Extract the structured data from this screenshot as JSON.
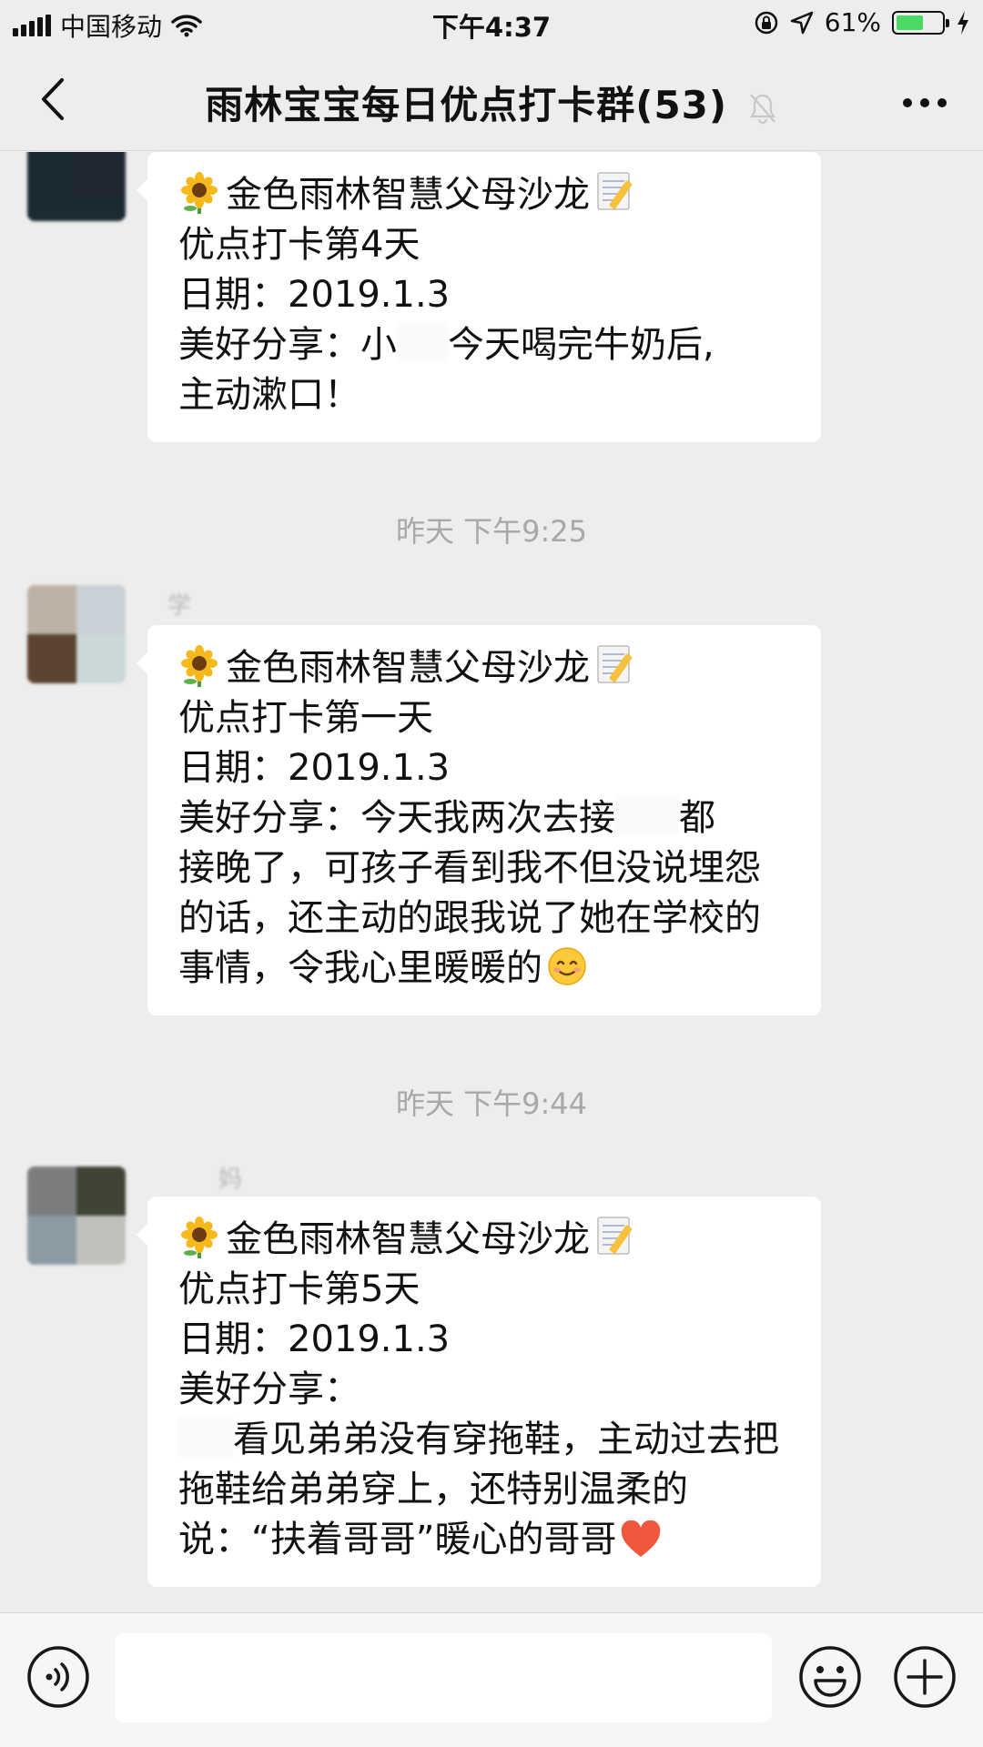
{
  "status_bar": {
    "carrier": "中国移动",
    "time": "下午4:37",
    "battery_percent": "61%",
    "battery_level": 0.61,
    "icons": [
      "signal-icon",
      "wifi-icon",
      "orientation-lock-icon",
      "location-icon",
      "battery-icon",
      "charging-icon"
    ]
  },
  "nav": {
    "title": "雨林宝宝每日优点打卡群(53)",
    "back_icon": "chevron-left-icon",
    "muted_icon": "bell-muted-icon",
    "more_icon": "more-icon"
  },
  "messages": [
    {
      "sender": "",
      "header": "金色雨林智慧父母沙龙",
      "day": "优点打卡第4天",
      "date": "日期：2019.1.3",
      "share_a": "美好分享：小",
      "share_b": "今天喝完牛奶后,",
      "share_c": "主动漱口！"
    },
    {
      "sender": "学",
      "header": "金色雨林智慧父母沙龙",
      "day": "优点打卡第一天",
      "date": "日期：2019.1.3",
      "share_a": "美好分享：今天我两次去接",
      "share_b": "都",
      "share_c": "接晚了，可孩子看到我不但没说埋怨的话，还主动的跟我说了她在学校的事情，令我心里暖暖的"
    },
    {
      "sender": "妈",
      "header": "金色雨林智慧父母沙龙",
      "day": "优点打卡第5天",
      "date": "日期：2019.1.3",
      "share_label": "美好分享：",
      "share_body": "看见弟弟没有穿拖鞋，主动过去把拖鞋给弟弟穿上，还特别温柔的说：“扶着哥哥”暖心的哥哥"
    }
  ],
  "timestamps": [
    "昨天 下午9:25",
    "昨天 下午9:44"
  ],
  "input_bar": {
    "icons": [
      "voice-icon",
      "emoji-icon",
      "plus-icon"
    ],
    "text": ""
  },
  "colors": {
    "background": "#ededed",
    "bubble": "#ffffff",
    "battery_fill": "#4cd964",
    "timestamp": "#a8a8a8"
  }
}
